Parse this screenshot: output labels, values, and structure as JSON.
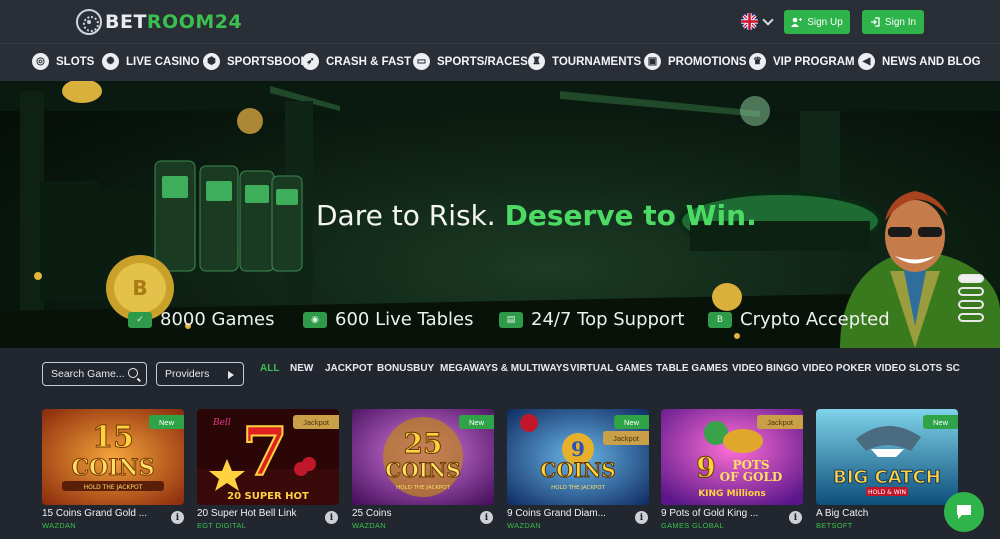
{
  "brand": {
    "logo_prefix": "BET",
    "logo_suffix": "ROOM24"
  },
  "header": {
    "language": "English",
    "signup_label": "Sign Up",
    "signin_label": "Sign In"
  },
  "nav": [
    {
      "label": "SLOTS",
      "icon": "slots-icon"
    },
    {
      "label": "LIVE CASINO",
      "icon": "live-casino-icon"
    },
    {
      "label": "SPORTSBOOK",
      "icon": "soccer-ball-icon"
    },
    {
      "label": "CRASH & FAST",
      "icon": "rocket-icon"
    },
    {
      "label": "SPORTS/RACES",
      "icon": "vr-goggles-icon"
    },
    {
      "label": "TOURNAMENTS",
      "icon": "trophy-icon"
    },
    {
      "label": "PROMOTIONS",
      "icon": "gift-icon"
    },
    {
      "label": "VIP PROGRAM",
      "icon": "crown-icon"
    },
    {
      "label": "NEWS AND BLOG",
      "icon": "megaphone-icon"
    }
  ],
  "hero": {
    "headline_main": "Dare to Risk. ",
    "headline_highlight": "Deserve to Win.",
    "features": [
      "8000 Games",
      "600 Live Tables",
      "24/7 Top Support",
      "Crypto Accepted"
    ],
    "slides_count": 4,
    "active_slide": 1
  },
  "filters": {
    "search_placeholder": "Search Game...",
    "providers_label": "Providers",
    "categories": [
      "ALL",
      "NEW",
      "JACKPOT",
      "BONUSBUY",
      "MEGAWAYS & MULTIWAYS",
      "VIRTUAL GAMES",
      "TABLE GAMES",
      "VIDEO BINGO",
      "VIDEO POKER",
      "VIDEO SLOTS",
      "SC"
    ],
    "active_category": "ALL"
  },
  "games": [
    {
      "title": "15 Coins Grand Gold ...",
      "provider": "WAZDAN",
      "badges": [
        "New"
      ],
      "art_text": "15 COINS",
      "art_sub": "HOLD THE JACKPOT"
    },
    {
      "title": "20 Super Hot Bell Link",
      "provider": "EGT DIGITAL",
      "badges": [
        "Jackpot"
      ],
      "art_text": "7",
      "art_sub": "20 SUPER HOT"
    },
    {
      "title": "25 Coins",
      "provider": "WAZDAN",
      "badges": [
        "New"
      ],
      "art_text": "25 COINS",
      "art_sub": "HOLD THE JACKPOT"
    },
    {
      "title": "9 Coins Grand Diam...",
      "provider": "WAZDAN",
      "badges": [
        "New",
        "Jackpot"
      ],
      "art_text": "9 COINS",
      "art_sub": "HOLD THE JACKPOT"
    },
    {
      "title": "9 Pots of Gold King ...",
      "provider": "GAMES GLOBAL",
      "badges": [
        "Jackpot"
      ],
      "art_text": "9 POTS OF GOLD",
      "art_sub": "KING Millions"
    },
    {
      "title": "A Big Catch",
      "provider": "BETSOFT",
      "badges": [
        "New"
      ],
      "art_text": "A BIG CATCH",
      "art_sub": "HOLD & WIN"
    }
  ]
}
